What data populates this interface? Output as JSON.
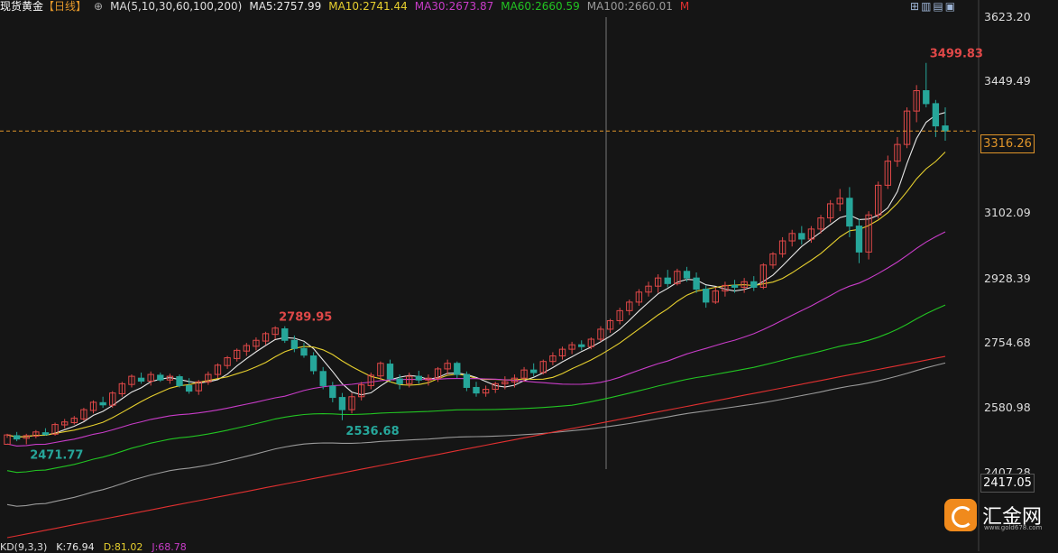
{
  "header": {
    "title": "现货黄金",
    "period": "【日线】",
    "ma_params": "MA(5,10,30,60,100,200)",
    "ma5": "MA5:2757.99",
    "ma10": "MA10:2741.44",
    "ma30": "MA30:2673.87",
    "ma60": "MA60:2660.59",
    "ma100": "MA100:2660.01",
    "ma200": "M"
  },
  "indicator": {
    "name": "KD(9,3,3)",
    "k": "K:76.94",
    "d": "D:81.02",
    "j": "J:68.78"
  },
  "price_axis": {
    "ticks": [
      "3623.20",
      "3449.49",
      "3102.09",
      "2928.39",
      "2754.68",
      "2580.98",
      "2407.28"
    ],
    "current_price": "3316.26",
    "bottom_label": "2417.05"
  },
  "logo": {
    "name": "汇金网",
    "url": "www.gold678.com"
  },
  "colors": {
    "background": "#151515",
    "up": "#e04848",
    "down": "#26a69a",
    "ma5": "#e8e8e8",
    "ma10": "#e6cf2e",
    "ma30": "#c83cc8",
    "ma60": "#22c422",
    "ma100": "#9a9a9a",
    "ma200": "#e03030",
    "current_line": "#e0952a"
  },
  "chart_data": {
    "type": "candlestick",
    "title": "现货黄金 日线",
    "ylim": [
      2407.28,
      3623.2
    ],
    "candles": [
      [
        2471.77,
        2500,
        2489,
        2497
      ],
      [
        2495,
        2505,
        2480,
        2486
      ],
      [
        2488,
        2500,
        2471.77,
        2495
      ],
      [
        2494,
        2510,
        2488,
        2505
      ],
      [
        2503,
        2515,
        2495,
        2498
      ],
      [
        2499,
        2530,
        2495,
        2525
      ],
      [
        2524,
        2540,
        2515,
        2532
      ],
      [
        2530,
        2548,
        2525,
        2542
      ],
      [
        2540,
        2570,
        2535,
        2565
      ],
      [
        2563,
        2590,
        2555,
        2585
      ],
      [
        2584,
        2600,
        2570,
        2578
      ],
      [
        2577,
        2615,
        2570,
        2610
      ],
      [
        2608,
        2640,
        2600,
        2635
      ],
      [
        2633,
        2660,
        2625,
        2655
      ],
      [
        2650,
        2665,
        2635,
        2642
      ],
      [
        2642,
        2668,
        2630,
        2660
      ],
      [
        2658,
        2665,
        2640,
        2645
      ],
      [
        2645,
        2662,
        2635,
        2655
      ],
      [
        2654,
        2660,
        2625,
        2630
      ],
      [
        2630,
        2650,
        2608,
        2615
      ],
      [
        2616,
        2645,
        2605,
        2640
      ],
      [
        2640,
        2668,
        2632,
        2660
      ],
      [
        2660,
        2690,
        2650,
        2685
      ],
      [
        2684,
        2710,
        2675,
        2705
      ],
      [
        2703,
        2730,
        2695,
        2725
      ],
      [
        2723,
        2745,
        2710,
        2738
      ],
      [
        2736,
        2760,
        2725,
        2752
      ],
      [
        2750,
        2775,
        2740,
        2770
      ],
      [
        2768,
        2789.95,
        2755,
        2785
      ],
      [
        2783,
        2790,
        2745,
        2752
      ],
      [
        2752,
        2765,
        2720,
        2730
      ],
      [
        2730,
        2745,
        2705,
        2712
      ],
      [
        2710,
        2720,
        2660,
        2670
      ],
      [
        2668,
        2680,
        2620,
        2630
      ],
      [
        2628,
        2640,
        2585,
        2598
      ],
      [
        2598,
        2610,
        2536.68,
        2565
      ],
      [
        2565,
        2610,
        2555,
        2600
      ],
      [
        2600,
        2640,
        2590,
        2632
      ],
      [
        2630,
        2665,
        2620,
        2658
      ],
      [
        2656,
        2695,
        2645,
        2690
      ],
      [
        2688,
        2700,
        2640,
        2648
      ],
      [
        2648,
        2660,
        2620,
        2635
      ],
      [
        2635,
        2665,
        2625,
        2655
      ],
      [
        2655,
        2670,
        2635,
        2645
      ],
      [
        2645,
        2660,
        2630,
        2650
      ],
      [
        2650,
        2680,
        2640,
        2675
      ],
      [
        2675,
        2700,
        2660,
        2690
      ],
      [
        2690,
        2695,
        2650,
        2660
      ],
      [
        2660,
        2668,
        2615,
        2625
      ],
      [
        2625,
        2640,
        2600,
        2610
      ],
      [
        2610,
        2630,
        2600,
        2620
      ],
      [
        2620,
        2640,
        2610,
        2635
      ],
      [
        2635,
        2655,
        2620,
        2640
      ],
      [
        2640,
        2660,
        2625,
        2650
      ],
      [
        2650,
        2680,
        2640,
        2672
      ],
      [
        2672,
        2690,
        2655,
        2665
      ],
      [
        2665,
        2700,
        2660,
        2695
      ],
      [
        2695,
        2720,
        2685,
        2710
      ],
      [
        2710,
        2735,
        2700,
        2728
      ],
      [
        2728,
        2748,
        2715,
        2740
      ],
      [
        2740,
        2752,
        2725,
        2735
      ],
      [
        2735,
        2760,
        2728,
        2755
      ],
      [
        2755,
        2790,
        2748,
        2782
      ],
      [
        2782,
        2810,
        2772,
        2805
      ],
      [
        2805,
        2840,
        2795,
        2832
      ],
      [
        2832,
        2862,
        2820,
        2855
      ],
      [
        2855,
        2890,
        2845,
        2882
      ],
      [
        2882,
        2910,
        2870,
        2898
      ],
      [
        2898,
        2930,
        2880,
        2920
      ],
      [
        2920,
        2942,
        2895,
        2905
      ],
      [
        2905,
        2945,
        2900,
        2938
      ],
      [
        2938,
        2950,
        2910,
        2920
      ],
      [
        2920,
        2935,
        2880,
        2890
      ],
      [
        2890,
        2900,
        2840,
        2855
      ],
      [
        2855,
        2895,
        2850,
        2885
      ],
      [
        2885,
        2910,
        2870,
        2900
      ],
      [
        2900,
        2915,
        2880,
        2895
      ],
      [
        2895,
        2920,
        2880,
        2910
      ],
      [
        2910,
        2925,
        2885,
        2895
      ],
      [
        2895,
        2960,
        2890,
        2955
      ],
      [
        2955,
        2990,
        2945,
        2985
      ],
      [
        2985,
        3030,
        2975,
        3020
      ],
      [
        3020,
        3050,
        3005,
        3040
      ],
      [
        3040,
        3060,
        3010,
        3025
      ],
      [
        3025,
        3060,
        3015,
        3052
      ],
      [
        3052,
        3090,
        3040,
        3082
      ],
      [
        3082,
        3130,
        3070,
        3120
      ],
      [
        3120,
        3160,
        3100,
        3135
      ],
      [
        3135,
        3165,
        3030,
        3060
      ],
      [
        3060,
        3080,
        2960,
        2990
      ],
      [
        2990,
        3100,
        2970,
        3090
      ],
      [
        3090,
        3180,
        3080,
        3170
      ],
      [
        3170,
        3250,
        3160,
        3235
      ],
      [
        3235,
        3300,
        3220,
        3280
      ],
      [
        3280,
        3380,
        3270,
        3370
      ],
      [
        3370,
        3440,
        3340,
        3425
      ],
      [
        3425,
        3499.83,
        3380,
        3390
      ],
      [
        3390,
        3400,
        3300,
        3330
      ],
      [
        3330,
        3380,
        3290,
        3316.26
      ]
    ],
    "annotations": [
      {
        "label": "2471.77",
        "value": 2471.77,
        "index": 2
      },
      {
        "label": "2789.95",
        "value": 2789.95,
        "index": 28
      },
      {
        "label": "2536.68",
        "value": 2536.68,
        "index": 35
      },
      {
        "label": "3499.83",
        "value": 3499.83,
        "index": 96
      }
    ],
    "current_price": 3316.26
  }
}
